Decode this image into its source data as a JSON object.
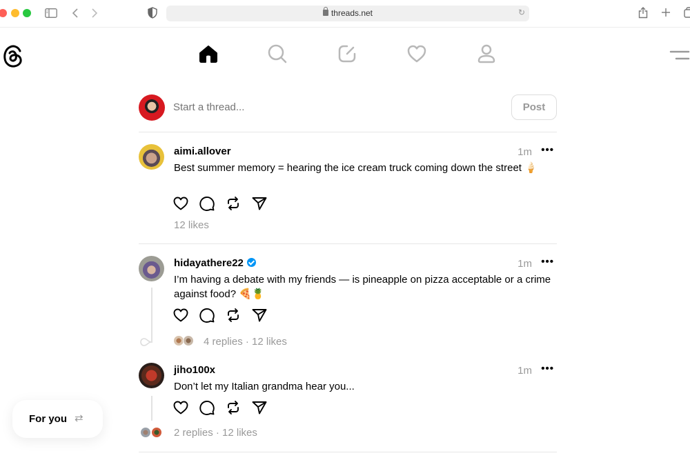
{
  "browser": {
    "url": "threads.net"
  },
  "nav": {
    "items": [
      {
        "name": "home",
        "active": true
      },
      {
        "name": "search",
        "active": false
      },
      {
        "name": "compose",
        "active": false
      },
      {
        "name": "activity",
        "active": false
      },
      {
        "name": "profile",
        "active": false
      }
    ]
  },
  "composer": {
    "placeholder": "Start a thread...",
    "post_label": "Post"
  },
  "posts": [
    {
      "username": "aimi.allover",
      "verified": false,
      "time": "1m",
      "more": "•••",
      "text": "Best summer memory = hearing the ice cream truck coming down the street 🍦",
      "stats": "12 likes"
    },
    {
      "username": "hidayathere22",
      "verified": true,
      "time": "1m",
      "more": "•••",
      "text": "I’m having a debate with my friends — is pineapple on pizza acceptable or a crime against food? 🍕🍍",
      "stats": "4 replies · 12 likes"
    },
    {
      "username": "jiho100x",
      "verified": false,
      "time": "1m",
      "more": "•••",
      "text": "Don’t let my Italian grandma hear you...",
      "stats": "2 replies · 12 likes"
    }
  ],
  "feed_switcher": {
    "label": "For you",
    "icon": "⇄"
  },
  "colors": {
    "accent_verified": "#0095f6",
    "muted_text": "#999999"
  }
}
